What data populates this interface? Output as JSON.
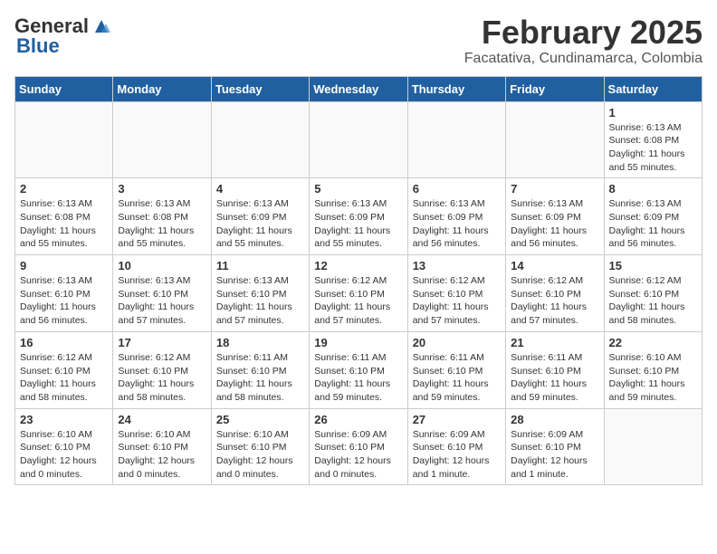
{
  "header": {
    "logo_general": "General",
    "logo_blue": "Blue",
    "month_title": "February 2025",
    "location": "Facatativa, Cundinamarca, Colombia"
  },
  "weekdays": [
    "Sunday",
    "Monday",
    "Tuesday",
    "Wednesday",
    "Thursday",
    "Friday",
    "Saturday"
  ],
  "weeks": [
    [
      {
        "day": "",
        "info": ""
      },
      {
        "day": "",
        "info": ""
      },
      {
        "day": "",
        "info": ""
      },
      {
        "day": "",
        "info": ""
      },
      {
        "day": "",
        "info": ""
      },
      {
        "day": "",
        "info": ""
      },
      {
        "day": "1",
        "info": "Sunrise: 6:13 AM\nSunset: 6:08 PM\nDaylight: 11 hours\nand 55 minutes."
      }
    ],
    [
      {
        "day": "2",
        "info": "Sunrise: 6:13 AM\nSunset: 6:08 PM\nDaylight: 11 hours\nand 55 minutes."
      },
      {
        "day": "3",
        "info": "Sunrise: 6:13 AM\nSunset: 6:08 PM\nDaylight: 11 hours\nand 55 minutes."
      },
      {
        "day": "4",
        "info": "Sunrise: 6:13 AM\nSunset: 6:09 PM\nDaylight: 11 hours\nand 55 minutes."
      },
      {
        "day": "5",
        "info": "Sunrise: 6:13 AM\nSunset: 6:09 PM\nDaylight: 11 hours\nand 55 minutes."
      },
      {
        "day": "6",
        "info": "Sunrise: 6:13 AM\nSunset: 6:09 PM\nDaylight: 11 hours\nand 56 minutes."
      },
      {
        "day": "7",
        "info": "Sunrise: 6:13 AM\nSunset: 6:09 PM\nDaylight: 11 hours\nand 56 minutes."
      },
      {
        "day": "8",
        "info": "Sunrise: 6:13 AM\nSunset: 6:09 PM\nDaylight: 11 hours\nand 56 minutes."
      }
    ],
    [
      {
        "day": "9",
        "info": "Sunrise: 6:13 AM\nSunset: 6:10 PM\nDaylight: 11 hours\nand 56 minutes."
      },
      {
        "day": "10",
        "info": "Sunrise: 6:13 AM\nSunset: 6:10 PM\nDaylight: 11 hours\nand 57 minutes."
      },
      {
        "day": "11",
        "info": "Sunrise: 6:13 AM\nSunset: 6:10 PM\nDaylight: 11 hours\nand 57 minutes."
      },
      {
        "day": "12",
        "info": "Sunrise: 6:12 AM\nSunset: 6:10 PM\nDaylight: 11 hours\nand 57 minutes."
      },
      {
        "day": "13",
        "info": "Sunrise: 6:12 AM\nSunset: 6:10 PM\nDaylight: 11 hours\nand 57 minutes."
      },
      {
        "day": "14",
        "info": "Sunrise: 6:12 AM\nSunset: 6:10 PM\nDaylight: 11 hours\nand 57 minutes."
      },
      {
        "day": "15",
        "info": "Sunrise: 6:12 AM\nSunset: 6:10 PM\nDaylight: 11 hours\nand 58 minutes."
      }
    ],
    [
      {
        "day": "16",
        "info": "Sunrise: 6:12 AM\nSunset: 6:10 PM\nDaylight: 11 hours\nand 58 minutes."
      },
      {
        "day": "17",
        "info": "Sunrise: 6:12 AM\nSunset: 6:10 PM\nDaylight: 11 hours\nand 58 minutes."
      },
      {
        "day": "18",
        "info": "Sunrise: 6:11 AM\nSunset: 6:10 PM\nDaylight: 11 hours\nand 58 minutes."
      },
      {
        "day": "19",
        "info": "Sunrise: 6:11 AM\nSunset: 6:10 PM\nDaylight: 11 hours\nand 59 minutes."
      },
      {
        "day": "20",
        "info": "Sunrise: 6:11 AM\nSunset: 6:10 PM\nDaylight: 11 hours\nand 59 minutes."
      },
      {
        "day": "21",
        "info": "Sunrise: 6:11 AM\nSunset: 6:10 PM\nDaylight: 11 hours\nand 59 minutes."
      },
      {
        "day": "22",
        "info": "Sunrise: 6:10 AM\nSunset: 6:10 PM\nDaylight: 11 hours\nand 59 minutes."
      }
    ],
    [
      {
        "day": "23",
        "info": "Sunrise: 6:10 AM\nSunset: 6:10 PM\nDaylight: 12 hours\nand 0 minutes."
      },
      {
        "day": "24",
        "info": "Sunrise: 6:10 AM\nSunset: 6:10 PM\nDaylight: 12 hours\nand 0 minutes."
      },
      {
        "day": "25",
        "info": "Sunrise: 6:10 AM\nSunset: 6:10 PM\nDaylight: 12 hours\nand 0 minutes."
      },
      {
        "day": "26",
        "info": "Sunrise: 6:09 AM\nSunset: 6:10 PM\nDaylight: 12 hours\nand 0 minutes."
      },
      {
        "day": "27",
        "info": "Sunrise: 6:09 AM\nSunset: 6:10 PM\nDaylight: 12 hours\nand 1 minute."
      },
      {
        "day": "28",
        "info": "Sunrise: 6:09 AM\nSunset: 6:10 PM\nDaylight: 12 hours\nand 1 minute."
      },
      {
        "day": "",
        "info": ""
      }
    ]
  ]
}
